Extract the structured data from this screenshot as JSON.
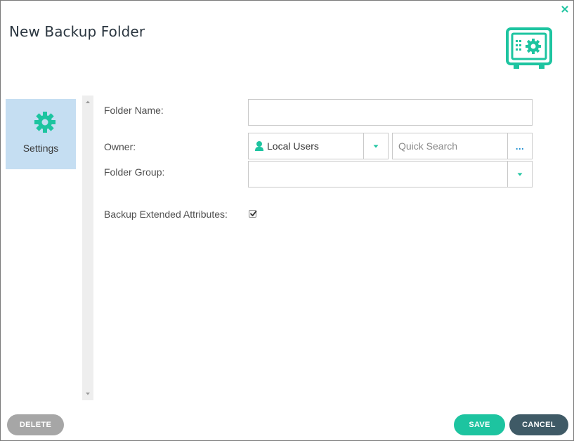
{
  "dialog": {
    "title": "New Backup Folder",
    "accent_color": "#1dc4a0"
  },
  "icons": {
    "close": "close-icon",
    "header": "safe-icon",
    "settings": "gear-icon",
    "owner_type": "user-icon"
  },
  "sidebar": {
    "items": [
      {
        "label": "Settings",
        "icon": "gear-icon",
        "selected": true
      }
    ]
  },
  "form": {
    "folder_name": {
      "label": "Folder Name:",
      "value": ""
    },
    "owner": {
      "label": "Owner:",
      "selected": "Local Users",
      "search_placeholder": "Quick Search",
      "more_label": "..."
    },
    "folder_group": {
      "label": "Folder Group:",
      "selected": ""
    },
    "backup_extended_attributes": {
      "label": "Backup Extended Attributes:",
      "checked": true
    }
  },
  "buttons": {
    "delete": "DELETE",
    "save": "SAVE",
    "cancel": "CANCEL"
  },
  "colors": {
    "accent": "#1dc4a0",
    "sidebar_selected": "#c5def2",
    "delete_button": "#a6a6a6",
    "cancel_button": "#3f5a66",
    "link": "#1a8ccf"
  }
}
